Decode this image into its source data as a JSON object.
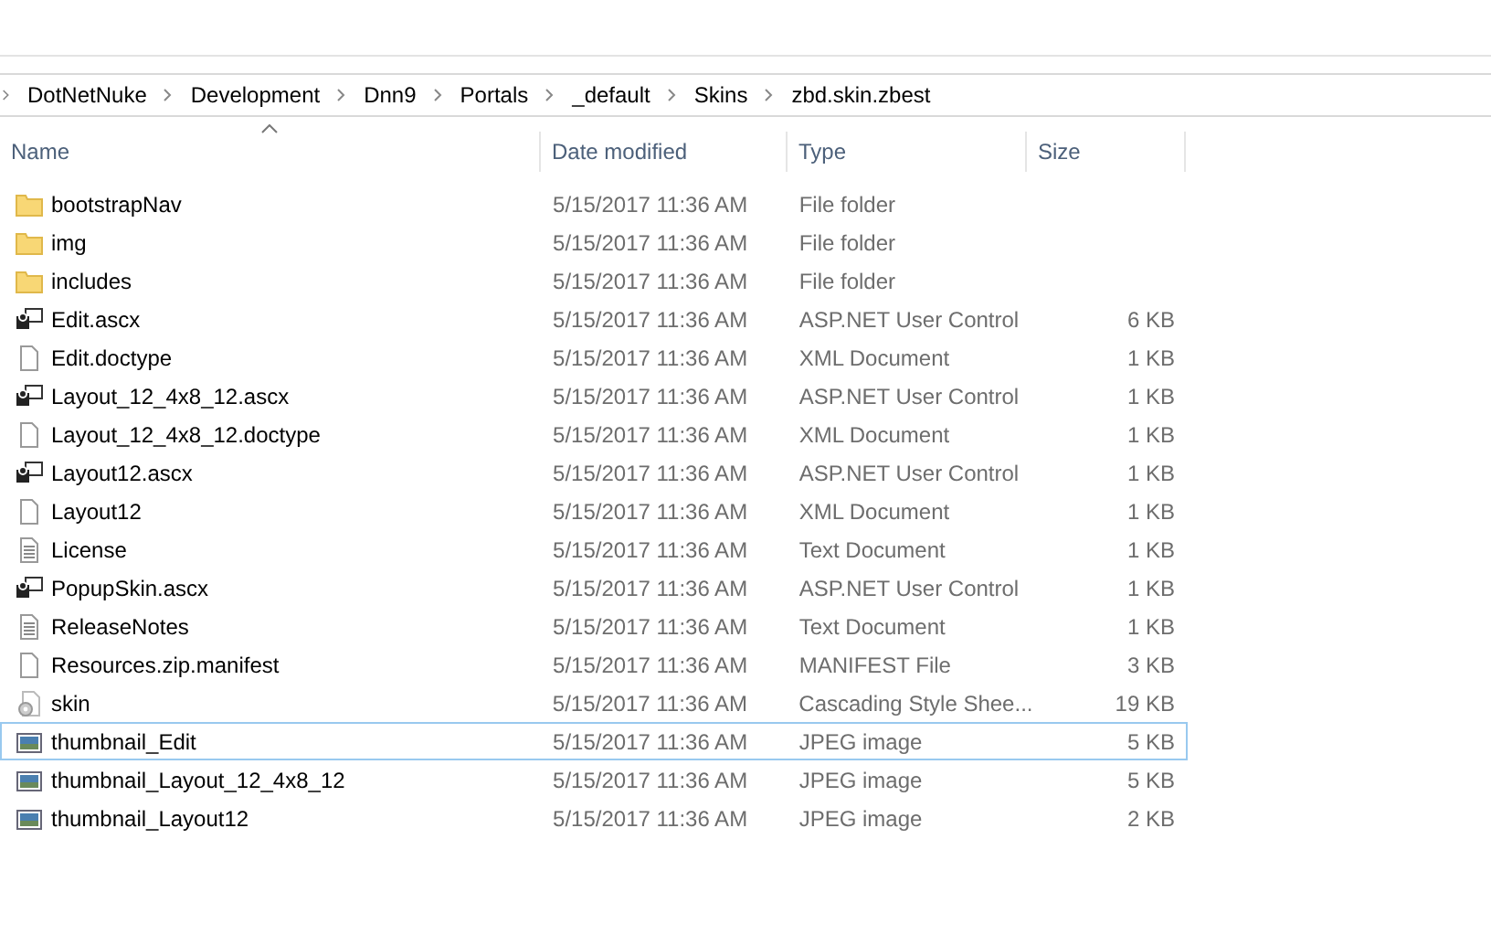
{
  "breadcrumb": [
    "DotNetNuke",
    "Development",
    "Dnn9",
    "Portals",
    "_default",
    "Skins",
    "zbd.skin.zbest"
  ],
  "columns": [
    {
      "label": "Name",
      "sorted": true
    },
    {
      "label": "Date modified",
      "sorted": false
    },
    {
      "label": "Type",
      "sorted": false
    },
    {
      "label": "Size",
      "sorted": false
    }
  ],
  "rows": [
    {
      "kind": "folder",
      "name": "bootstrapNav",
      "date": "5/15/2017 11:36 AM",
      "type": "File folder",
      "size": "",
      "focused": false
    },
    {
      "kind": "folder",
      "name": "img",
      "date": "5/15/2017 11:36 AM",
      "type": "File folder",
      "size": "",
      "focused": false
    },
    {
      "kind": "folder",
      "name": "includes",
      "date": "5/15/2017 11:36 AM",
      "type": "File folder",
      "size": "",
      "focused": false
    },
    {
      "kind": "control",
      "name": "Edit.ascx",
      "date": "5/15/2017 11:36 AM",
      "type": "ASP.NET User Control",
      "size": "6 KB",
      "focused": false
    },
    {
      "kind": "file",
      "name": "Edit.doctype",
      "date": "5/15/2017 11:36 AM",
      "type": "XML Document",
      "size": "1 KB",
      "focused": false
    },
    {
      "kind": "control",
      "name": "Layout_12_4x8_12.ascx",
      "date": "5/15/2017 11:36 AM",
      "type": "ASP.NET User Control",
      "size": "1 KB",
      "focused": false
    },
    {
      "kind": "file",
      "name": "Layout_12_4x8_12.doctype",
      "date": "5/15/2017 11:36 AM",
      "type": "XML Document",
      "size": "1 KB",
      "focused": false
    },
    {
      "kind": "control",
      "name": "Layout12.ascx",
      "date": "5/15/2017 11:36 AM",
      "type": "ASP.NET User Control",
      "size": "1 KB",
      "focused": false
    },
    {
      "kind": "file",
      "name": "Layout12",
      "date": "5/15/2017 11:36 AM",
      "type": "XML Document",
      "size": "1 KB",
      "focused": false
    },
    {
      "kind": "text",
      "name": "License",
      "date": "5/15/2017 11:36 AM",
      "type": "Text Document",
      "size": "1 KB",
      "focused": false
    },
    {
      "kind": "control",
      "name": "PopupSkin.ascx",
      "date": "5/15/2017 11:36 AM",
      "type": "ASP.NET User Control",
      "size": "1 KB",
      "focused": false
    },
    {
      "kind": "text",
      "name": "ReleaseNotes",
      "date": "5/15/2017 11:36 AM",
      "type": "Text Document",
      "size": "1 KB",
      "focused": false
    },
    {
      "kind": "file",
      "name": "Resources.zip.manifest",
      "date": "5/15/2017 11:36 AM",
      "type": "MANIFEST File",
      "size": "3 KB",
      "focused": false
    },
    {
      "kind": "settings",
      "name": "skin",
      "date": "5/15/2017 11:36 AM",
      "type": "Cascading Style Shee...",
      "size": "19 KB",
      "focused": false
    },
    {
      "kind": "image",
      "name": "thumbnail_Edit",
      "date": "5/15/2017 11:36 AM",
      "type": "JPEG image",
      "size": "5 KB",
      "focused": true
    },
    {
      "kind": "image",
      "name": "thumbnail_Layout_12_4x8_12",
      "date": "5/15/2017 11:36 AM",
      "type": "JPEG image",
      "size": "5 KB",
      "focused": false
    },
    {
      "kind": "image",
      "name": "thumbnail_Layout12",
      "date": "5/15/2017 11:36 AM",
      "type": "JPEG image",
      "size": "2 KB",
      "focused": false
    }
  ]
}
